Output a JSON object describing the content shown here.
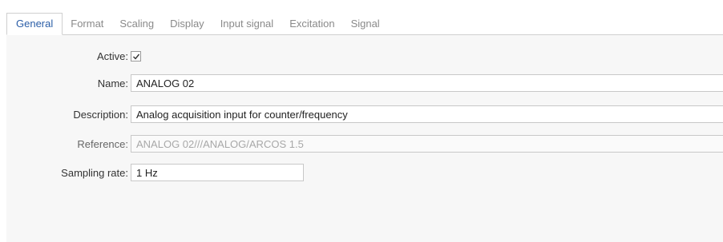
{
  "tabs": [
    {
      "label": "General",
      "active": true
    },
    {
      "label": "Format",
      "active": false
    },
    {
      "label": "Scaling",
      "active": false
    },
    {
      "label": "Display",
      "active": false
    },
    {
      "label": "Input signal",
      "active": false
    },
    {
      "label": "Excitation",
      "active": false
    },
    {
      "label": "Signal",
      "active": false
    }
  ],
  "form": {
    "active": {
      "label": "Active:",
      "checked": true,
      "icon": "checkmark-icon"
    },
    "name": {
      "label": "Name:",
      "value": "ANALOG 02"
    },
    "description": {
      "label": "Description:",
      "value": "Analog acquisition input for counter/frequency"
    },
    "reference": {
      "label": "Reference:",
      "value": "ANALOG 02///ANALOG/ARCOS 1.5"
    },
    "sampling_rate": {
      "label": "Sampling rate:",
      "value": "1 Hz"
    }
  },
  "colors": {
    "active_tab_text": "#2b5ea7",
    "inactive_tab_text": "#8a8a8a",
    "panel_bg": "#f7f7f7",
    "disabled_text": "#a8a8a8"
  }
}
